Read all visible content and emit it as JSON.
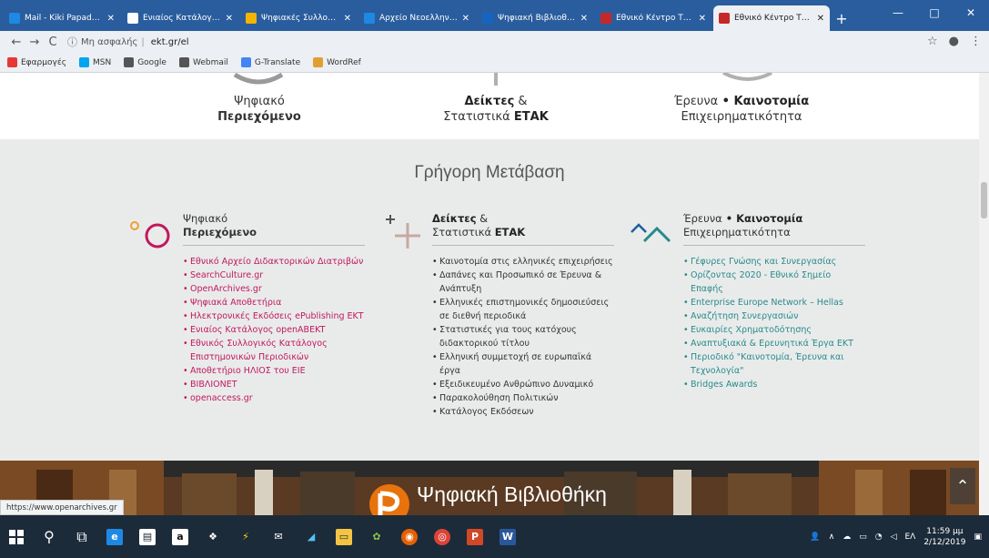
{
  "browser": {
    "tabs": [
      {
        "title": "Mail - Kiki Papadopouli",
        "color": "#1e88e5",
        "active": false
      },
      {
        "title": "Ενιαίος Κατάλογος Συ...",
        "color": "#ffffff",
        "active": false
      },
      {
        "title": "Ψηφιακές Συλλογές – Ι...",
        "color": "#f4b400",
        "active": false
      },
      {
        "title": "Αρχείο Νεοελληνικής /...",
        "color": "#1e88e5",
        "active": false
      },
      {
        "title": "Ψηφιακή Βιβλιοθήκη...",
        "color": "#1565c0",
        "active": false
      },
      {
        "title": "Εθνικό Κέντρο Τεκμηρ...",
        "color": "#c62828",
        "active": false
      },
      {
        "title": "Εθνικό Κέντρο Τεκμηρ...",
        "color": "#c62828",
        "active": true
      }
    ],
    "new_tab": "+",
    "window_controls": {
      "minimize": "—",
      "maximize": "□",
      "close": "✕"
    },
    "nav": {
      "back": "←",
      "forward": "→",
      "reload": "C"
    },
    "omnibox": {
      "security": "Μη ασφαλής",
      "separator": "|",
      "url": "ekt.gr/el"
    },
    "bookmarks": [
      {
        "label": "Εφαρμογές",
        "color": "#e53935"
      },
      {
        "label": "MSN",
        "color": "#00a4ef"
      },
      {
        "label": "Google",
        "color": "#555555"
      },
      {
        "label": "Webmail",
        "color": "#555555"
      },
      {
        "label": "G-Translate",
        "color": "#4285f4"
      },
      {
        "label": "WordRef",
        "color": "#e0a030"
      }
    ]
  },
  "topband": {
    "digital": {
      "line1": "Ψηφιακό",
      "line2": "Περιεχόμενο"
    },
    "indicators": {
      "line1_bold": "Δείκτες",
      "line1_rest": " &",
      "line2_pre": "Στατιστικά ",
      "line2_bold": "ΕΤΑΚ"
    },
    "research": {
      "line1_pre": "Έρευνα",
      "line1_dot": " • ",
      "line1_bold": "Καινοτομία",
      "line2": "Επιχειρηματικότητα"
    }
  },
  "quicklinks": {
    "title": "Γρήγορη Μετάβαση",
    "col1": {
      "head1": "Ψηφιακό",
      "head2": "Περιεχόμενο",
      "items": [
        "Εθνικό Αρχείο Διδακτορικών Διατριβών",
        "SearchCulture.gr",
        "OpenArchives.gr",
        "Ψηφιακά Αποθετήρια",
        "Ηλεκτρονικές Εκδόσεις ePublishing ΕΚΤ",
        "Ενιαίος Κατάλογος openABEKT",
        "Εθνικός Συλλογικός Κατάλογος Επιστημονικών Περιοδικών",
        "Αποθετήριο ΗΛΙΟΣ του ΕΙΕ",
        "ΒΙΒΛΙΟΝΕΤ",
        "openaccess.gr"
      ]
    },
    "col2": {
      "head1_bold": "Δείκτες",
      "head1_rest": " &",
      "head2_pre": "Στατιστικά ",
      "head2_bold": "ΕΤΑΚ",
      "items": [
        "Καινοτομία στις ελληνικές επιχειρήσεις",
        "Δαπάνες και Προσωπικό σε Έρευνα & Ανάπτυξη",
        "Ελληνικές επιστημονικές δημοσιεύσεις σε διεθνή περιοδικά",
        "Στατιστικές για τους κατόχους διδακτορικού τίτλου",
        "Ελληνική συμμετοχή σε ευρωπαϊκά έργα",
        "Εξειδικευμένο Ανθρώπινο Δυναμικό",
        "Παρακολούθηση Πολιτικών",
        "Κατάλογος Εκδόσεων"
      ]
    },
    "col3": {
      "head1_pre": "Έρευνα",
      "head1_dot": " • ",
      "head1_bold": "Καινοτομία",
      "head2": "Επιχειρηματικότητα",
      "items": [
        "Γέφυρες Γνώσης και Συνεργασίας",
        "Ορίζοντας 2020 - Εθνικό Σημείο Επαφής",
        "Enterprise Europe Network – Hellas",
        "Αναζήτηση Συνεργασιών",
        "Ευκαιρίες Χρηματοδότησης",
        "Αναπτυξιακά & Ερευνητικά Έργα ΕΚΤ",
        "Περιοδικό \"Καινοτομία, Έρευνα και Τεχνολογία\"",
        "Bridges Awards"
      ]
    }
  },
  "banner": {
    "logo_text": "Ψηφιακή Βιβλιοθήκη"
  },
  "status_url": "https://www.openarchives.gr",
  "taskbar": {
    "tray_lang": "ΕΛ",
    "time": "11:59 μμ",
    "date": "2/12/2019"
  },
  "colors": {
    "digital": "#c2185b",
    "digital_accent": "#f0a030",
    "indicators": "#999999",
    "research": "#2a8a8a",
    "research_accent": "#1e5f9e"
  }
}
